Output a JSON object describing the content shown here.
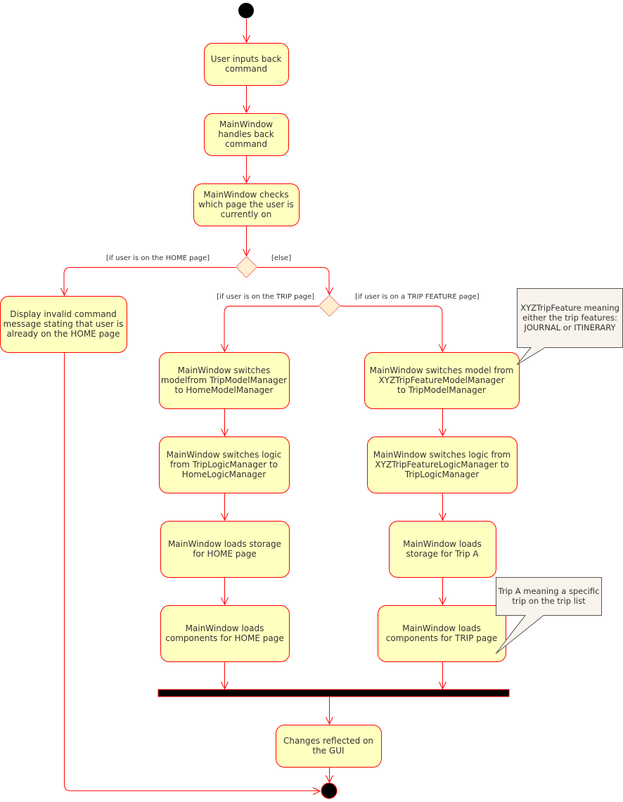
{
  "colors": {
    "stroke": "#ff0000",
    "activity_fill": "#ffffc0",
    "decision_fill": "#ffefd0",
    "note_fill": "#f8f4ec",
    "note_stroke": "#555555",
    "bar": "#000000"
  },
  "activities": {
    "user_inputs": [
      "User inputs back",
      "command"
    ],
    "handles": [
      "MainWindow",
      "handles back",
      "command"
    ],
    "checks": [
      "MainWindow checks",
      "which page the user is",
      "currently on"
    ],
    "invalid": [
      "Display invalid command",
      "message stating that user is",
      "already on the HOME page"
    ],
    "trip_model": [
      "MainWindow switches",
      "modelfrom TripModelManager",
      "to HomeModelManager"
    ],
    "trip_logic": [
      "MainWindow switches logic",
      "from TripLogicManager to",
      "HomeLogicManager"
    ],
    "trip_storage": [
      "MainWindow loads storage",
      "for HOME page"
    ],
    "trip_components": [
      "MainWindow loads",
      "components for HOME page"
    ],
    "feature_model": [
      "MainWindow switches model from",
      "XYZTripFeatureModelManager",
      "to TripModelManager"
    ],
    "feature_logic": [
      "MainWindow switches logic from",
      "XYZTripFeatureLogicManager to",
      "TripLogicManager"
    ],
    "feature_storage": [
      "MainWindow loads",
      "storage for Trip A"
    ],
    "feature_components": [
      "MainWindow loads",
      "components for TRIP page"
    ],
    "gui": [
      "Changes reflected on",
      "the GUI"
    ]
  },
  "guards": {
    "home": "[if user is on the HOME page]",
    "else": "[else]",
    "trip": "[if user is on the TRIP page]",
    "feature": "[if user is on a TRIP FEATURE page]"
  },
  "notes": {
    "xyz": [
      "XYZTripFeature meaning",
      "either the trip features:",
      "JOURNAL or ITINERARY"
    ],
    "tripa": [
      "Trip A meaning a specific",
      "trip on the trip list"
    ]
  }
}
